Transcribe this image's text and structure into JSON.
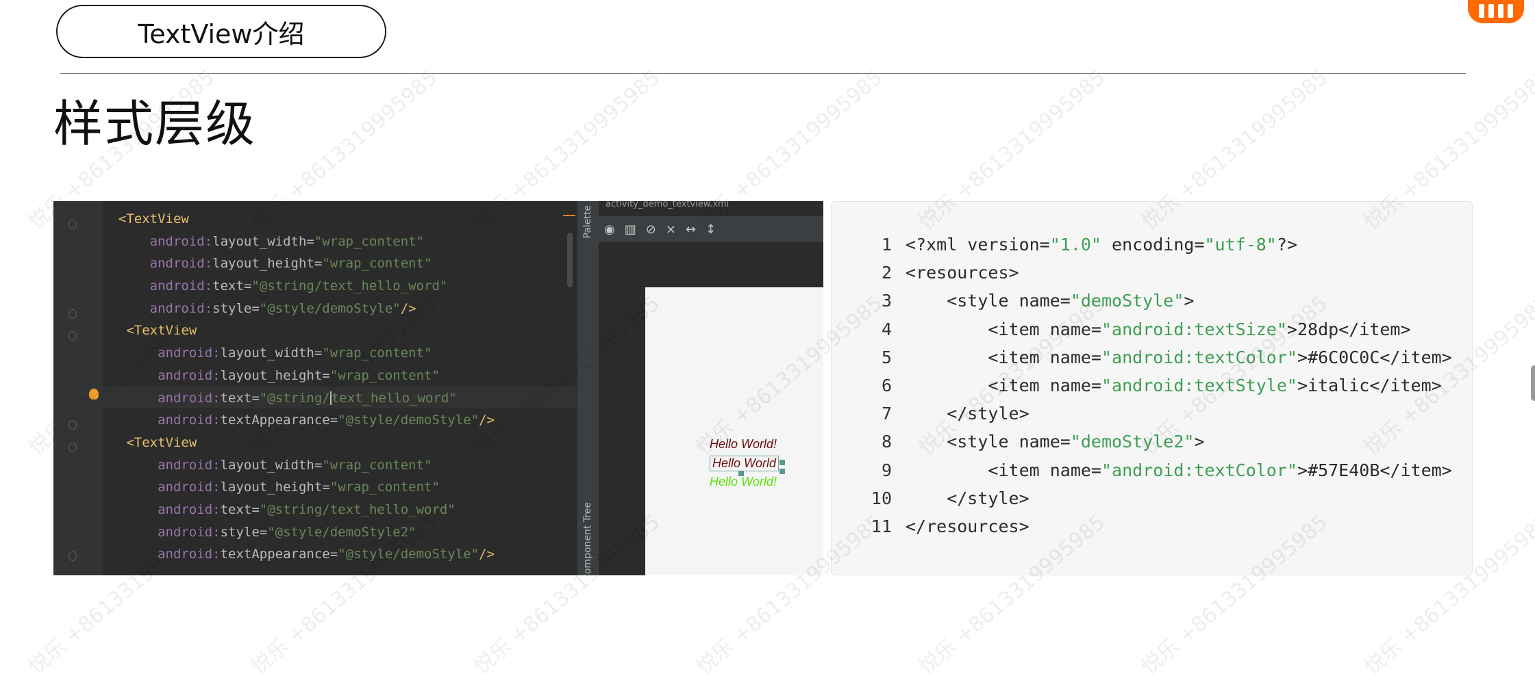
{
  "slide": {
    "title": "TextView介绍",
    "heading": "样式层级"
  },
  "brand": {
    "color": "#ff6900",
    "icon": "xiaomi-logo"
  },
  "ide": {
    "file_tab": "activity_demo_textview.xml",
    "palette_label": "Palette",
    "component_tree_label": "Component Tree",
    "toolbar_icons": [
      "eye-icon",
      "blueprint-icon",
      "magnet-off-icon",
      "clear-constraints-icon",
      "horizontal-arrows-icon",
      "vertical-arrows-icon"
    ],
    "code": [
      {
        "indent": "",
        "tag": "<TextView",
        "attr": "",
        "val": "",
        "end": ""
      },
      {
        "indent": "    ",
        "tag": "",
        "attr": "layout_width",
        "val": "\"wrap_content\"",
        "end": ""
      },
      {
        "indent": "    ",
        "tag": "",
        "attr": "layout_height",
        "val": "\"wrap_content\"",
        "end": ""
      },
      {
        "indent": "    ",
        "tag": "",
        "attr": "text",
        "val": "\"@string/text_hello_word\"",
        "end": ""
      },
      {
        "indent": "    ",
        "tag": "",
        "attr": "style",
        "val": "\"@style/demoStyle\"",
        "end": "/>"
      },
      {
        "indent": " ",
        "tag": "<TextView",
        "attr": "",
        "val": "",
        "end": ""
      },
      {
        "indent": "     ",
        "tag": "",
        "attr": "layout_width",
        "val": "\"wrap_content\"",
        "end": ""
      },
      {
        "indent": "     ",
        "tag": "",
        "attr": "layout_height",
        "val": "\"wrap_content\"",
        "end": ""
      },
      {
        "indent": "     ",
        "tag": "",
        "attr": "text",
        "val": "\"@string/text_hello_word\"",
        "end": ""
      },
      {
        "indent": "     ",
        "tag": "",
        "attr": "textAppearance",
        "val": "\"@style/demoStyle\"",
        "end": "/>"
      },
      {
        "indent": " ",
        "tag": "<TextView",
        "attr": "",
        "val": "",
        "end": ""
      },
      {
        "indent": "     ",
        "tag": "",
        "attr": "layout_width",
        "val": "\"wrap_content\"",
        "end": ""
      },
      {
        "indent": "     ",
        "tag": "",
        "attr": "layout_height",
        "val": "\"wrap_content\"",
        "end": ""
      },
      {
        "indent": "     ",
        "tag": "",
        "attr": "text",
        "val": "\"@string/text_hello_word\"",
        "end": ""
      },
      {
        "indent": "     ",
        "tag": "",
        "attr": "style",
        "val": "\"@style/demoStyle2\"",
        "end": ""
      },
      {
        "indent": "     ",
        "tag": "",
        "attr": "textAppearance",
        "val": "\"@style/demoStyle\"",
        "end": "/>"
      }
    ],
    "ns_prefix": "android:",
    "preview": {
      "text1": "Hello World!",
      "text2": "Hello World",
      "text3": "Hello World!",
      "color_dark_red": "#6C0C0C",
      "color_green": "#57E40B"
    }
  },
  "xml_file": {
    "lines": [
      {
        "n": "1",
        "parts": [
          [
            "<?xml version=",
            ""
          ],
          [
            "\"1.0\"",
            "s"
          ],
          [
            " encoding=",
            ""
          ],
          [
            "\"utf-8\"",
            "s"
          ],
          [
            "?>",
            ""
          ]
        ]
      },
      {
        "n": "2",
        "parts": [
          [
            "<resources>",
            ""
          ]
        ]
      },
      {
        "n": "3",
        "parts": [
          [
            "    <style name=",
            ""
          ],
          [
            "\"demoStyle\"",
            "s"
          ],
          [
            ">",
            ""
          ]
        ]
      },
      {
        "n": "4",
        "parts": [
          [
            "        <item name=",
            ""
          ],
          [
            "\"android:textSize\"",
            "s"
          ],
          [
            ">28dp</item>",
            ""
          ]
        ]
      },
      {
        "n": "5",
        "parts": [
          [
            "        <item name=",
            ""
          ],
          [
            "\"android:textColor\"",
            "s"
          ],
          [
            ">#6C0C0C</item>",
            ""
          ]
        ]
      },
      {
        "n": "6",
        "parts": [
          [
            "        <item name=",
            ""
          ],
          [
            "\"android:textStyle\"",
            "s"
          ],
          [
            ">italic</item>",
            ""
          ]
        ]
      },
      {
        "n": "7",
        "parts": [
          [
            "    </style>",
            ""
          ]
        ]
      },
      {
        "n": "8",
        "parts": [
          [
            "    <style name=",
            ""
          ],
          [
            "\"demoStyle2\"",
            "s"
          ],
          [
            ">",
            ""
          ]
        ]
      },
      {
        "n": "9",
        "parts": [
          [
            "        <item name=",
            ""
          ],
          [
            "\"android:textColor\"",
            "s"
          ],
          [
            ">#57E40B</item>",
            ""
          ]
        ]
      },
      {
        "n": "10",
        "parts": [
          [
            "    </style>",
            ""
          ]
        ]
      },
      {
        "n": "11",
        "parts": [
          [
            "</resources>",
            ""
          ]
        ]
      }
    ]
  },
  "watermark": "悦乐 +8613319995985"
}
